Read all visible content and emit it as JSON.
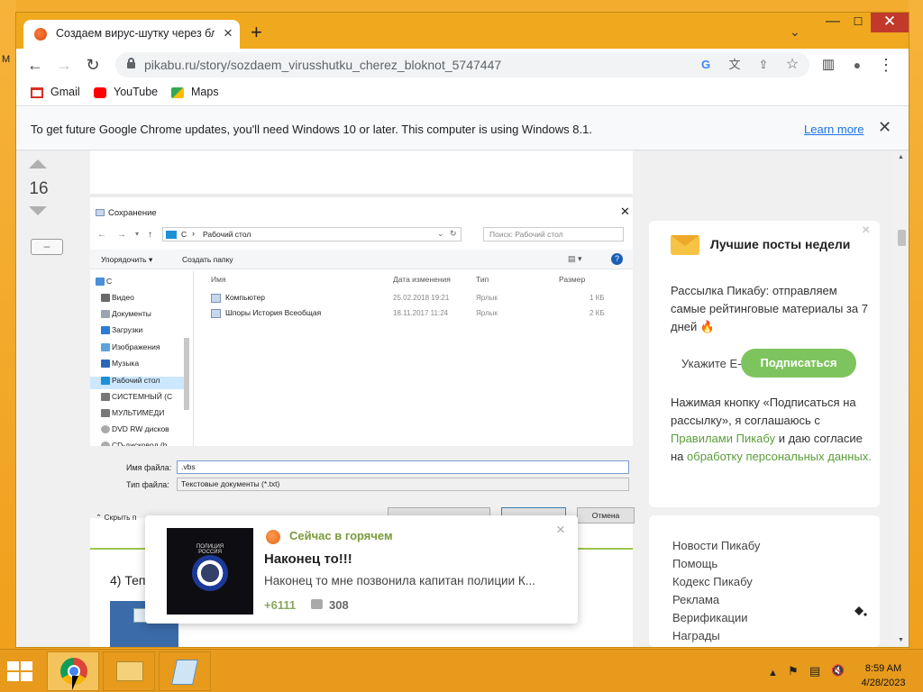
{
  "desktop": {
    "partial_text": "М"
  },
  "browser": {
    "tab": {
      "title": "Создаем вирус-шутку через блокнот",
      "close": "×"
    },
    "new_tab": "+",
    "tab_search": "⌄",
    "window_controls": {
      "minimize": "—",
      "maximize": "☐",
      "close": "✕"
    },
    "nav": {
      "back": "←",
      "forward": "→",
      "reload": "↻"
    },
    "url": "pikabu.ru/story/sozdaem_virusshutku_cherez_bloknot_5747447",
    "omnibox_icons": {
      "google": "G",
      "translate": "文",
      "share": "⇪",
      "star": "☆"
    },
    "toolbar_icons": {
      "sidebar": "▥",
      "profile": "●",
      "menu": "⋮"
    },
    "bookmarks": [
      {
        "label": "Gmail",
        "icon": "gmail-icon",
        "color": "#d93025"
      },
      {
        "label": "YouTube",
        "icon": "youtube-icon",
        "color": "#ff0000"
      },
      {
        "label": "Maps",
        "icon": "maps-icon",
        "color": "#34a853"
      }
    ],
    "infobar": {
      "text": "To get future Google Chrome updates, you'll need Windows 10 or later. This computer is using Windows 8.1.",
      "link": "Learn more",
      "close": "✕"
    }
  },
  "post": {
    "rating": "16",
    "collapse": "–",
    "save_dialog": {
      "title": "Сохранение",
      "path": [
        "С",
        "›",
        "Рабочий стол"
      ],
      "search_placeholder": "Поиск: Рабочий стол",
      "organize": "Упорядочить ▾",
      "new_folder": "Создать папку",
      "columns": [
        "Имя",
        "Дата изменения",
        "Тип",
        "Размер"
      ],
      "files": [
        {
          "name": "Компьютер",
          "date": "25.02.2018 19:21",
          "type": "Ярлык",
          "size": "1 КБ"
        },
        {
          "name": "Шпоры История Всеобщая",
          "date": "18.11.2017 11:24",
          "type": "Ярлык",
          "size": "2 КБ"
        }
      ],
      "sidebar": [
        "С",
        "Видео",
        "Документы",
        "Загрузки",
        "Изображения",
        "Музыка",
        "Рабочий стол",
        "СИСТЕМНЫЙ (C",
        "МУЛЬТИМЕДИ",
        "DVD RW дисков",
        "CD-дисковод (h"
      ],
      "filename_label": "Имя файла:",
      "filename_value": ".vbs",
      "filetype_label": "Тип файла:",
      "filetype_value": "Текстовые документы (*.txt)",
      "hide_folders": "Скрыть п",
      "cancel": "Отмена"
    },
    "step_text": "4) Теп"
  },
  "sidebar": {
    "newsletter": {
      "title": "Лучшие посты недели",
      "body": "Рассылка Пикабу: отправляем самые рейтинговые материалы за 7 дней 🔥",
      "email_placeholder": "Укажите E-mail",
      "subscribe": "Подписаться",
      "legal_1": "Нажимая кнопку «Подписаться на рассылку», я соглашаюсь с ",
      "legal_link1": "Правилами Пикабу",
      "legal_2": " и даю согласие на ",
      "legal_link2": "обработку персональных данных.",
      "close": "×"
    },
    "links": [
      "Новости Пикабу",
      "Помощь",
      "Кодекс Пикабу",
      "Реклама",
      "Верификации",
      "Награды"
    ]
  },
  "toast": {
    "section": "Сейчас в горячем",
    "title": "Наконец то!!!",
    "text": "Наконец то мне позвонила капитан полиции К...",
    "score": "+6111",
    "comments": "308",
    "badge_text": "ПОЛИЦИЯ РОССИЯ",
    "close": "×"
  },
  "taskbar": {
    "time": "8:59 AM",
    "date": "4/28/2023",
    "tray_icons": [
      "up-arrow-icon",
      "flag-icon",
      "network-icon",
      "speaker-muted-icon"
    ],
    "tray_glyphs": [
      "▲",
      "⚑",
      "▤",
      "🔇"
    ]
  }
}
